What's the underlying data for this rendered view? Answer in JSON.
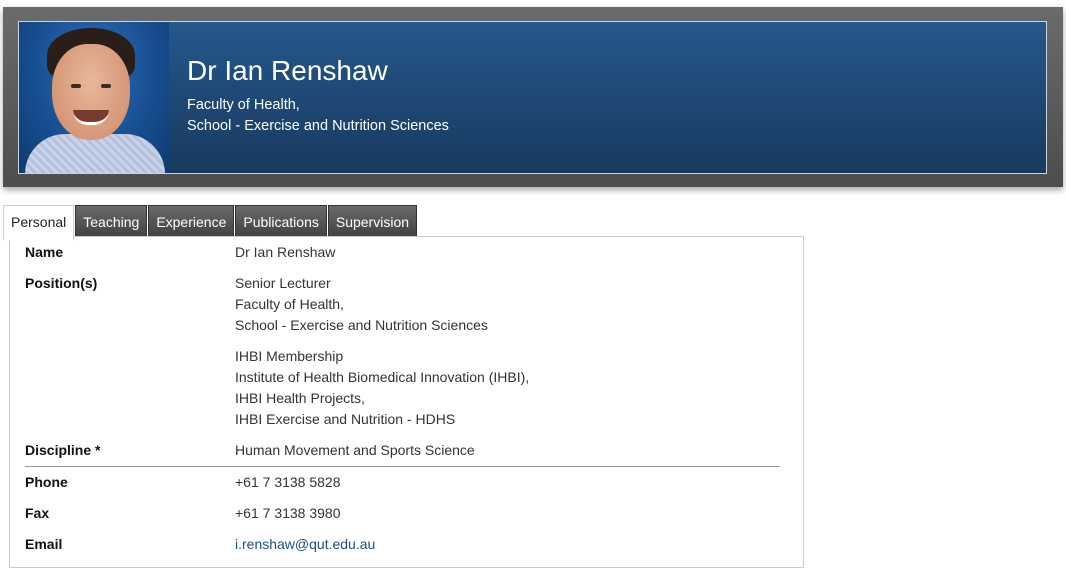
{
  "header": {
    "name": "Dr Ian Renshaw",
    "faculty": "Faculty of Health,",
    "school": "School - Exercise and Nutrition Sciences"
  },
  "tabs": [
    {
      "label": "Personal",
      "active": true
    },
    {
      "label": "Teaching",
      "active": false
    },
    {
      "label": "Experience",
      "active": false
    },
    {
      "label": "Publications",
      "active": false
    },
    {
      "label": "Supervision",
      "active": false
    }
  ],
  "details": {
    "name_label": "Name",
    "name_value": "Dr Ian Renshaw",
    "positions_label": "Position(s)",
    "position1": [
      "Senior Lecturer",
      "Faculty of Health,",
      "School - Exercise and Nutrition Sciences"
    ],
    "position2": [
      "IHBI Membership",
      "Institute of Health Biomedical Innovation (IHBI),",
      "IHBI Health Projects,",
      "IHBI Exercise and Nutrition - HDHS"
    ],
    "discipline_label": "Discipline *",
    "discipline_value": "Human Movement and Sports Science",
    "phone_label": "Phone",
    "phone_value": "+61 7 3138 5828",
    "fax_label": "Fax",
    "fax_value": "+61 7 3138 3980",
    "email_label": "Email",
    "email_value": "i.renshaw@qut.edu.au"
  },
  "colors": {
    "header_blue": "#1f4a77",
    "tab_dark": "#4a4a4a",
    "link": "#1a4f8b"
  }
}
